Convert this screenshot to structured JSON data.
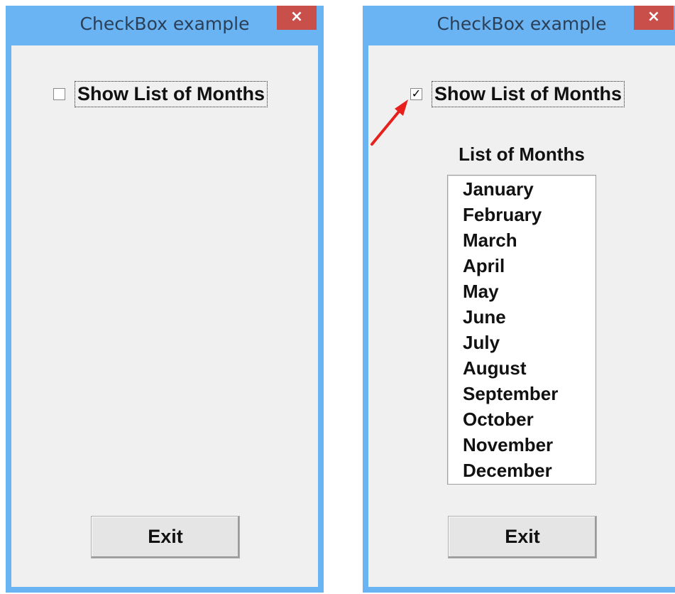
{
  "windows": [
    {
      "title": "CheckBox example",
      "close_glyph": "×",
      "checkbox": {
        "label": "Show List of Months",
        "checked": false,
        "glyph": ""
      },
      "exit_label": "Exit"
    },
    {
      "title": "CheckBox example",
      "close_glyph": "×",
      "checkbox": {
        "label": "Show List of Months",
        "checked": true,
        "glyph": "✓"
      },
      "list_title": "List of Months",
      "months": [
        "January",
        "February",
        "March",
        "April",
        "May",
        "June",
        "July",
        "August",
        "September",
        "October",
        "November",
        "December"
      ],
      "exit_label": "Exit"
    }
  ],
  "colors": {
    "frame": "#6ab4f4",
    "close_button": "#c9504a",
    "client": "#f0f0f0",
    "arrow": "#e8201c"
  }
}
